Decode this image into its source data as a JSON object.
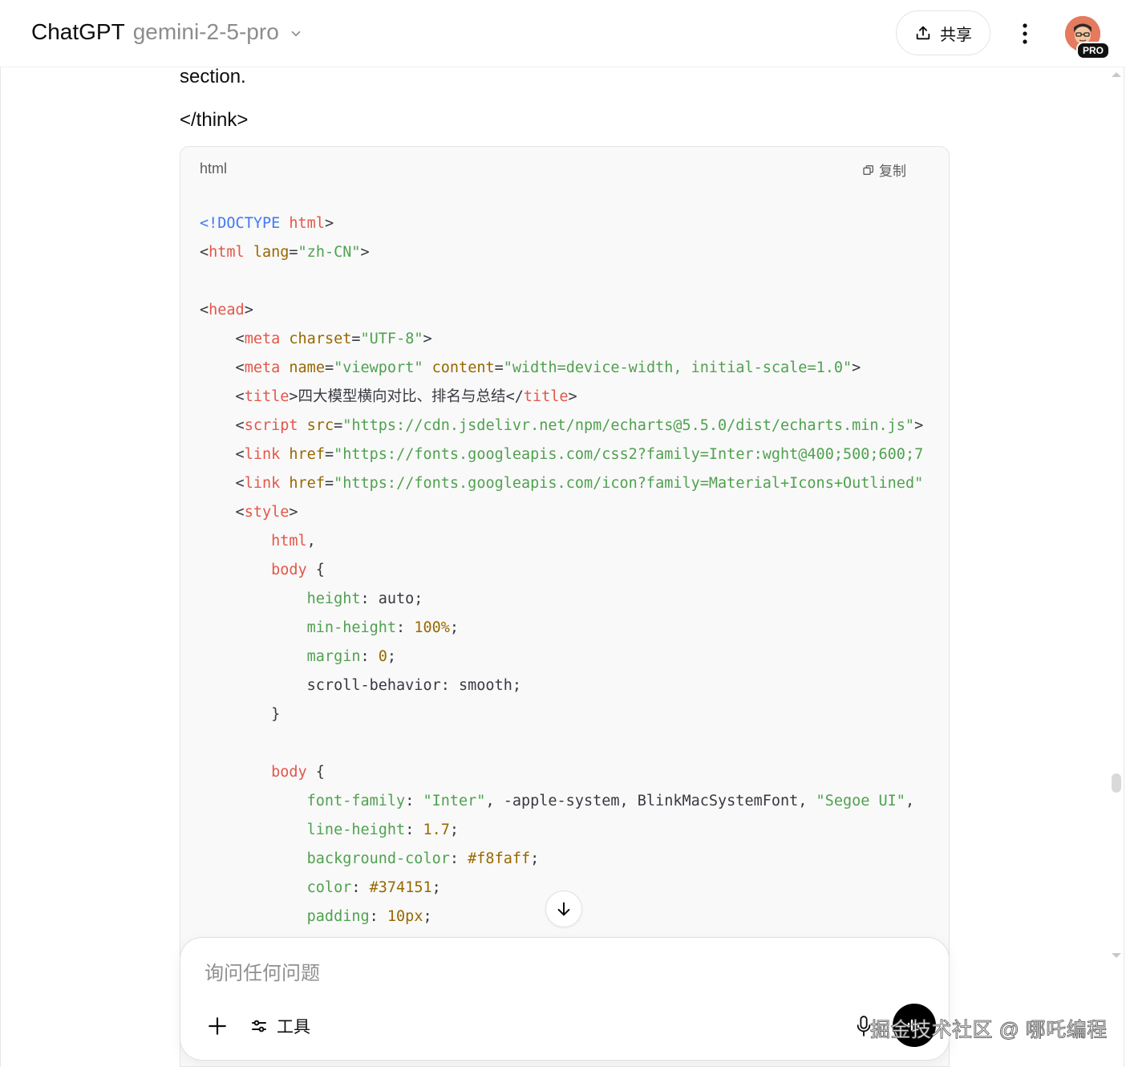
{
  "header": {
    "app_name": "ChatGPT",
    "model_name": "gemini-2-5-pro",
    "share_label": "共享",
    "pro_badge": "PRO"
  },
  "message": {
    "line1": "section.",
    "line2": "</think>"
  },
  "code_block": {
    "language": "html",
    "copy_label": "复制",
    "lines": [
      [
        {
          "c": "t-doc",
          "t": "<!DOCTYPE "
        },
        {
          "c": "t-tag",
          "t": "html"
        },
        {
          "c": "t-plain",
          "t": ">"
        }
      ],
      [
        {
          "c": "t-plain",
          "t": "<"
        },
        {
          "c": "t-tag",
          "t": "html"
        },
        {
          "c": "t-plain",
          "t": " "
        },
        {
          "c": "t-attr",
          "t": "lang"
        },
        {
          "c": "t-plain",
          "t": "="
        },
        {
          "c": "t-str",
          "t": "\"zh-CN\""
        },
        {
          "c": "t-plain",
          "t": ">"
        }
      ],
      [],
      [
        {
          "c": "t-plain",
          "t": "<"
        },
        {
          "c": "t-tag",
          "t": "head"
        },
        {
          "c": "t-plain",
          "t": ">"
        }
      ],
      [
        {
          "c": "t-plain",
          "t": "    <"
        },
        {
          "c": "t-tag",
          "t": "meta"
        },
        {
          "c": "t-plain",
          "t": " "
        },
        {
          "c": "t-attr",
          "t": "charset"
        },
        {
          "c": "t-plain",
          "t": "="
        },
        {
          "c": "t-str",
          "t": "\"UTF-8\""
        },
        {
          "c": "t-plain",
          "t": ">"
        }
      ],
      [
        {
          "c": "t-plain",
          "t": "    <"
        },
        {
          "c": "t-tag",
          "t": "meta"
        },
        {
          "c": "t-plain",
          "t": " "
        },
        {
          "c": "t-attr",
          "t": "name"
        },
        {
          "c": "t-plain",
          "t": "="
        },
        {
          "c": "t-str",
          "t": "\"viewport\""
        },
        {
          "c": "t-plain",
          "t": " "
        },
        {
          "c": "t-attr",
          "t": "content"
        },
        {
          "c": "t-plain",
          "t": "="
        },
        {
          "c": "t-str",
          "t": "\"width=device-width, initial-scale=1.0\""
        },
        {
          "c": "t-plain",
          "t": ">"
        }
      ],
      [
        {
          "c": "t-plain",
          "t": "    <"
        },
        {
          "c": "t-tag",
          "t": "title"
        },
        {
          "c": "t-plain",
          "t": ">"
        },
        {
          "c": "t-plain t-cjk",
          "t": "四大模型横向对比、排名与总结"
        },
        {
          "c": "t-plain",
          "t": "</"
        },
        {
          "c": "t-tag",
          "t": "title"
        },
        {
          "c": "t-plain",
          "t": ">"
        }
      ],
      [
        {
          "c": "t-plain",
          "t": "    <"
        },
        {
          "c": "t-tag",
          "t": "script"
        },
        {
          "c": "t-plain",
          "t": " "
        },
        {
          "c": "t-attr",
          "t": "src"
        },
        {
          "c": "t-plain",
          "t": "="
        },
        {
          "c": "t-str",
          "t": "\"https://cdn.jsdelivr.net/npm/echarts@5.5.0/dist/echarts.min.js\""
        },
        {
          "c": "t-plain",
          "t": ">"
        }
      ],
      [
        {
          "c": "t-plain",
          "t": "    <"
        },
        {
          "c": "t-tag",
          "t": "link"
        },
        {
          "c": "t-plain",
          "t": " "
        },
        {
          "c": "t-attr",
          "t": "href"
        },
        {
          "c": "t-plain",
          "t": "="
        },
        {
          "c": "t-str",
          "t": "\"https://fonts.googleapis.com/css2?family=Inter:wght@400;500;600;7"
        }
      ],
      [
        {
          "c": "t-plain",
          "t": "    <"
        },
        {
          "c": "t-tag",
          "t": "link"
        },
        {
          "c": "t-plain",
          "t": " "
        },
        {
          "c": "t-attr",
          "t": "href"
        },
        {
          "c": "t-plain",
          "t": "="
        },
        {
          "c": "t-str",
          "t": "\"https://fonts.googleapis.com/icon?family=Material+Icons+Outlined\""
        }
      ],
      [
        {
          "c": "t-plain",
          "t": "    <"
        },
        {
          "c": "t-tag",
          "t": "style"
        },
        {
          "c": "t-plain",
          "t": ">"
        }
      ],
      [
        {
          "c": "t-plain",
          "t": "        "
        },
        {
          "c": "t-tag",
          "t": "html"
        },
        {
          "c": "t-plain",
          "t": ","
        }
      ],
      [
        {
          "c": "t-plain",
          "t": "        "
        },
        {
          "c": "t-tag",
          "t": "body"
        },
        {
          "c": "t-plain",
          "t": " {"
        }
      ],
      [
        {
          "c": "t-plain",
          "t": "            "
        },
        {
          "c": "t-prop",
          "t": "height"
        },
        {
          "c": "t-plain",
          "t": ": auto;"
        }
      ],
      [
        {
          "c": "t-plain",
          "t": "            "
        },
        {
          "c": "t-prop",
          "t": "min-height"
        },
        {
          "c": "t-plain",
          "t": ": "
        },
        {
          "c": "t-num",
          "t": "100%"
        },
        {
          "c": "t-plain",
          "t": ";"
        }
      ],
      [
        {
          "c": "t-plain",
          "t": "            "
        },
        {
          "c": "t-prop",
          "t": "margin"
        },
        {
          "c": "t-plain",
          "t": ": "
        },
        {
          "c": "t-num",
          "t": "0"
        },
        {
          "c": "t-plain",
          "t": ";"
        }
      ],
      [
        {
          "c": "t-plain",
          "t": "            scroll-behavior: smooth;"
        }
      ],
      [
        {
          "c": "t-plain",
          "t": "        }"
        }
      ],
      [],
      [
        {
          "c": "t-plain",
          "t": "        "
        },
        {
          "c": "t-tag",
          "t": "body"
        },
        {
          "c": "t-plain",
          "t": " {"
        }
      ],
      [
        {
          "c": "t-plain",
          "t": "            "
        },
        {
          "c": "t-prop",
          "t": "font-family"
        },
        {
          "c": "t-plain",
          "t": ": "
        },
        {
          "c": "t-str",
          "t": "\"Inter\""
        },
        {
          "c": "t-plain",
          "t": ", -apple-system, BlinkMacSystemFont, "
        },
        {
          "c": "t-str",
          "t": "\"Segoe UI\""
        },
        {
          "c": "t-plain",
          "t": ","
        }
      ],
      [
        {
          "c": "t-plain",
          "t": "            "
        },
        {
          "c": "t-prop",
          "t": "line-height"
        },
        {
          "c": "t-plain",
          "t": ": "
        },
        {
          "c": "t-num",
          "t": "1.7"
        },
        {
          "c": "t-plain",
          "t": ";"
        }
      ],
      [
        {
          "c": "t-plain",
          "t": "            "
        },
        {
          "c": "t-prop",
          "t": "background-color"
        },
        {
          "c": "t-plain",
          "t": ": "
        },
        {
          "c": "t-num",
          "t": "#f8faff"
        },
        {
          "c": "t-plain",
          "t": ";"
        }
      ],
      [
        {
          "c": "t-plain",
          "t": "            "
        },
        {
          "c": "t-prop",
          "t": "color"
        },
        {
          "c": "t-plain",
          "t": ": "
        },
        {
          "c": "t-num",
          "t": "#374151"
        },
        {
          "c": "t-plain",
          "t": ";"
        }
      ],
      [
        {
          "c": "t-plain",
          "t": "            "
        },
        {
          "c": "t-prop",
          "t": "padding"
        },
        {
          "c": "t-plain",
          "t": ": "
        },
        {
          "c": "t-num",
          "t": "10px"
        },
        {
          "c": "t-plain",
          "t": ";"
        }
      ]
    ]
  },
  "composer": {
    "placeholder": "询问任何问题",
    "tools_label": "工具"
  },
  "watermark": "掘金技术社区 @ 哪吒编程",
  "colors": {
    "tag": "#e45649",
    "attr": "#986801",
    "string": "#50a14f",
    "doctype": "#4078f2"
  }
}
